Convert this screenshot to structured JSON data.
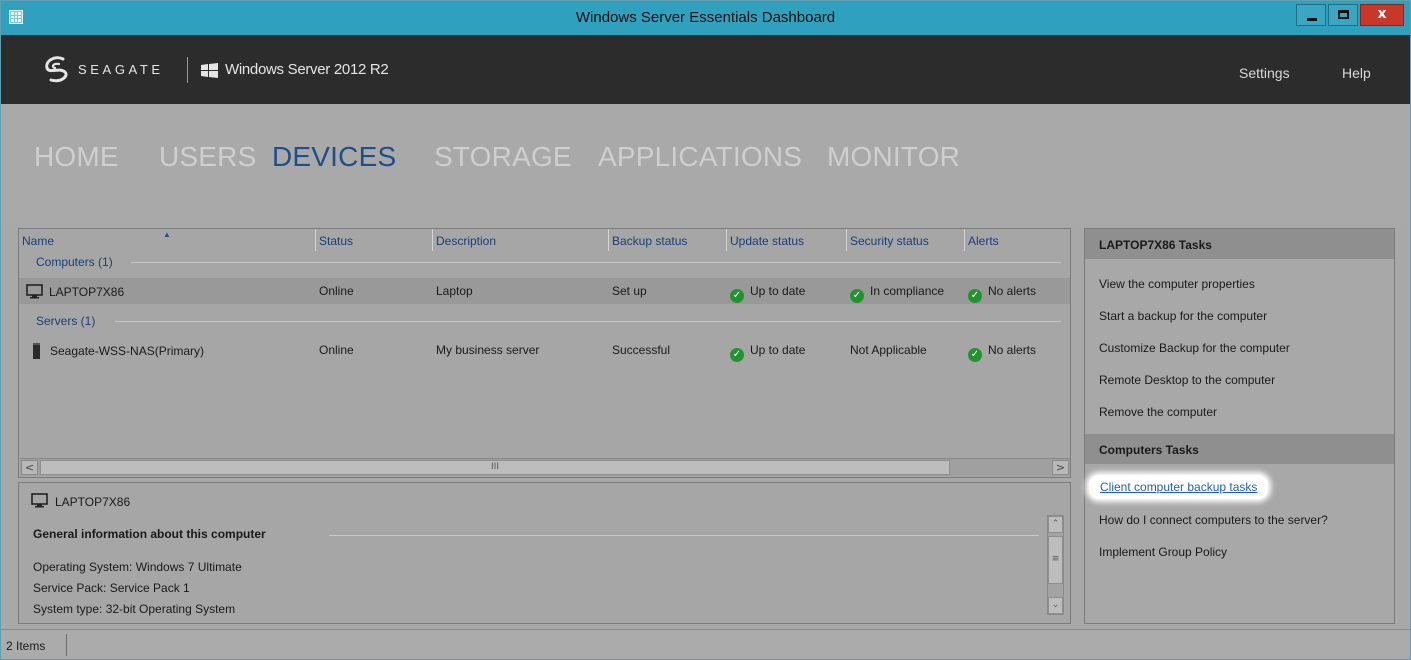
{
  "window": {
    "title": "Windows Server Essentials Dashboard",
    "close_glyph": "x"
  },
  "brand": {
    "company": "SEAGATE",
    "product": "Windows Server 2012 R2",
    "links": {
      "settings": "Settings",
      "help": "Help"
    }
  },
  "nav": {
    "items": [
      "HOME",
      "USERS",
      "DEVICES",
      "STORAGE",
      "APPLICATIONS",
      "MONITOR"
    ],
    "active": "DEVICES",
    "active_color": "#1f4e8c"
  },
  "grid": {
    "columns": [
      "Name",
      "Status",
      "Description",
      "Backup status",
      "Update status",
      "Security status",
      "Alerts"
    ],
    "groups": [
      {
        "label": "Computers (1)",
        "rows": [
          {
            "name": "LAPTOP7X86",
            "icon": "monitor-icon",
            "status": "Online",
            "description": "Laptop",
            "backup": "Set up",
            "update": "Up to date",
            "security": "In compliance",
            "alerts": "No alerts",
            "selected": true
          }
        ]
      },
      {
        "label": "Servers (1)",
        "rows": [
          {
            "name": "Seagate-WSS-NAS(Primary)",
            "icon": "server-icon",
            "status": "Online",
            "description": "My business server",
            "backup": "Successful",
            "update": "Up to date",
            "security": "Not Applicable",
            "alerts": "No alerts",
            "selected": false
          }
        ]
      }
    ],
    "scroll_left": "<",
    "scroll_right": ">",
    "scroll_grip": "III",
    "status_ok_color": "#23932f"
  },
  "details": {
    "title": "LAPTOP7X86",
    "section": "General information about this computer",
    "lines": [
      "Operating System: Windows 7 Ultimate",
      "Service Pack: Service Pack 1",
      "System type: 32-bit Operating System"
    ]
  },
  "tasks": {
    "computer_header": "LAPTOP7X86 Tasks",
    "computer_tasks": [
      "View the computer properties",
      "Start a backup for the computer",
      "Customize Backup for the computer",
      "Remote Desktop to the computer",
      "Remove the computer"
    ],
    "general_header": "Computers Tasks",
    "general_tasks": [
      "Client computer backup tasks",
      "How do I connect computers to the server?",
      "Implement Group Policy"
    ],
    "highlighted": "Client computer backup tasks"
  },
  "status_bar": {
    "items": "2 Items"
  }
}
